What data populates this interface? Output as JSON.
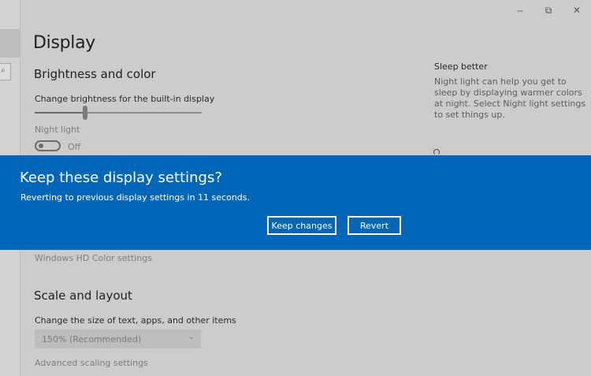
{
  "window": {
    "minimize_glyph": "–",
    "restore_glyph": "⧉",
    "close_glyph": "✕"
  },
  "nav": {
    "search_glyph": "⌕"
  },
  "page": {
    "title": "Display"
  },
  "brightness": {
    "section_title": "Brightness and color",
    "slider_label": "Change brightness for the built-in display",
    "brightness_value": 0.3,
    "night_light_label": "Night light",
    "night_light_state": "Off"
  },
  "hd_color": {
    "link": "Windows HD Color settings"
  },
  "scale": {
    "section_title": "Scale and layout",
    "size_label": "Change the size of text, apps, and other items",
    "size_value": "150% (Recommended)",
    "advanced_link": "Advanced scaling settings"
  },
  "side": {
    "title": "Sleep better",
    "text": "Night light can help you get to sleep by displaying warmer colors at night. Select Night light settings to set things up."
  },
  "dialog": {
    "title": "Keep these display settings?",
    "message": "Reverting to previous display settings in 11 seconds.",
    "keep_label": "Keep changes",
    "revert_label": "Revert"
  },
  "colors": {
    "banner_blue": "#0067b8"
  }
}
